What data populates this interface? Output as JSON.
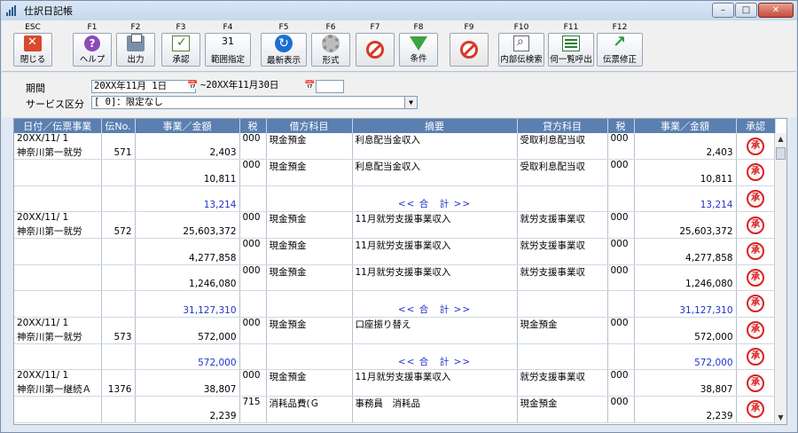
{
  "window": {
    "title": "仕訳日記帳",
    "minimize": "–",
    "maximize": "□",
    "close": "✕"
  },
  "toolbar": [
    {
      "key": "ESC",
      "label": "閉じる",
      "icon": "close-icon"
    },
    {
      "key": "F1",
      "label": "ヘルプ",
      "icon": "help-icon"
    },
    {
      "key": "F2",
      "label": "出力",
      "icon": "print-icon"
    },
    {
      "key": "F3",
      "label": "承認",
      "icon": "approve-icon"
    },
    {
      "key": "F4",
      "label": "範囲指定",
      "icon": "calendar-icon",
      "icon_text": "31"
    },
    {
      "key": "F5",
      "label": "最新表示",
      "icon": "refresh-icon"
    },
    {
      "key": "F6",
      "label": "形式",
      "icon": "gear-icon"
    },
    {
      "key": "F7",
      "label": "",
      "icon": "ban-icon"
    },
    {
      "key": "F8",
      "label": "条件",
      "icon": "filter-icon"
    },
    {
      "key": "F9",
      "label": "",
      "icon": "ban-icon"
    },
    {
      "key": "F10",
      "label": "内部伝検索",
      "icon": "search-icon"
    },
    {
      "key": "F11",
      "label": "伺一覧呼出",
      "icon": "list-icon"
    },
    {
      "key": "F12",
      "label": "伝票修正",
      "icon": "edit-icon"
    }
  ],
  "filters": {
    "period_label": "期間",
    "period_from": "20XX年11月 1日",
    "period_to": "~20XX年11月30日",
    "service_label": "サービス区分",
    "service_value": "[      0]：限定なし"
  },
  "columns": [
    "日付／伝票事業",
    "伝No.",
    "事業／金額",
    "税",
    "借方科目",
    "摘要",
    "貸方科目",
    "税",
    "事業／金額",
    "承認"
  ],
  "stamp_text": "承認",
  "rows": [
    {
      "date": "20XX/11/ 1",
      "biz": "神奈川第一就労",
      "no": "571",
      "debit_amt": "2,403",
      "tax1": "000",
      "debit": "現金預金",
      "desc": "利息配当金収入",
      "credit": "受取利息配当収",
      "tax2": "000",
      "credit_amt": "2,403",
      "total": false
    },
    {
      "date": "",
      "biz": "",
      "no": "",
      "debit_amt": "10,811",
      "tax1": "000",
      "debit": "現金預金",
      "desc": "利息配当金収入",
      "credit": "受取利息配当収",
      "tax2": "000",
      "credit_amt": "10,811",
      "total": false
    },
    {
      "date": "",
      "biz": "",
      "no": "",
      "debit_amt": "13,214",
      "tax1": "",
      "debit": "",
      "desc": "<< 合　計 >>",
      "credit": "",
      "tax2": "",
      "credit_amt": "13,214",
      "total": true
    },
    {
      "date": "20XX/11/ 1",
      "biz": "神奈川第一就労",
      "no": "572",
      "debit_amt": "25,603,372",
      "tax1": "000",
      "debit": "現金預金",
      "desc": "11月就労支援事業収入",
      "credit": "就労支援事業収",
      "tax2": "000",
      "credit_amt": "25,603,372",
      "total": false
    },
    {
      "date": "",
      "biz": "",
      "no": "",
      "debit_amt": "4,277,858",
      "tax1": "000",
      "debit": "現金預金",
      "desc": "11月就労支援事業収入",
      "credit": "就労支援事業収",
      "tax2": "000",
      "credit_amt": "4,277,858",
      "total": false
    },
    {
      "date": "",
      "biz": "",
      "no": "",
      "debit_amt": "1,246,080",
      "tax1": "000",
      "debit": "現金預金",
      "desc": "11月就労支援事業収入",
      "credit": "就労支援事業収",
      "tax2": "000",
      "credit_amt": "1,246,080",
      "total": false
    },
    {
      "date": "",
      "biz": "",
      "no": "",
      "debit_amt": "31,127,310",
      "tax1": "",
      "debit": "",
      "desc": "<< 合　計 >>",
      "credit": "",
      "tax2": "",
      "credit_amt": "31,127,310",
      "total": true
    },
    {
      "date": "20XX/11/ 1",
      "biz": "神奈川第一就労",
      "no": "573",
      "debit_amt": "572,000",
      "tax1": "000",
      "debit": "現金預金",
      "desc": "口座振り替え",
      "credit": "現金預金",
      "tax2": "000",
      "credit_amt": "572,000",
      "total": false
    },
    {
      "date": "",
      "biz": "",
      "no": "",
      "debit_amt": "572,000",
      "tax1": "",
      "debit": "",
      "desc": "<< 合　計 >>",
      "credit": "",
      "tax2": "",
      "credit_amt": "572,000",
      "total": true
    },
    {
      "date": "20XX/11/ 1",
      "biz": "神奈川第一継続Ａ",
      "no": "1376",
      "debit_amt": "38,807",
      "tax1": "000",
      "debit": "現金預金",
      "desc": "11月就労支援事業収入",
      "credit": "就労支援事業収",
      "tax2": "000",
      "credit_amt": "38,807",
      "total": false
    },
    {
      "date": "",
      "biz": "",
      "no": "",
      "debit_amt": "2,239",
      "tax1": "715",
      "debit": "消耗品費(Ｇ",
      "desc": "事務員　消耗品",
      "credit": "現金預金",
      "tax2": "000",
      "credit_amt": "2,239",
      "total": false
    }
  ],
  "colors": {
    "header_bg": "#5a7fb0",
    "total_text": "#1f33c9",
    "stamp": "#d82222"
  }
}
